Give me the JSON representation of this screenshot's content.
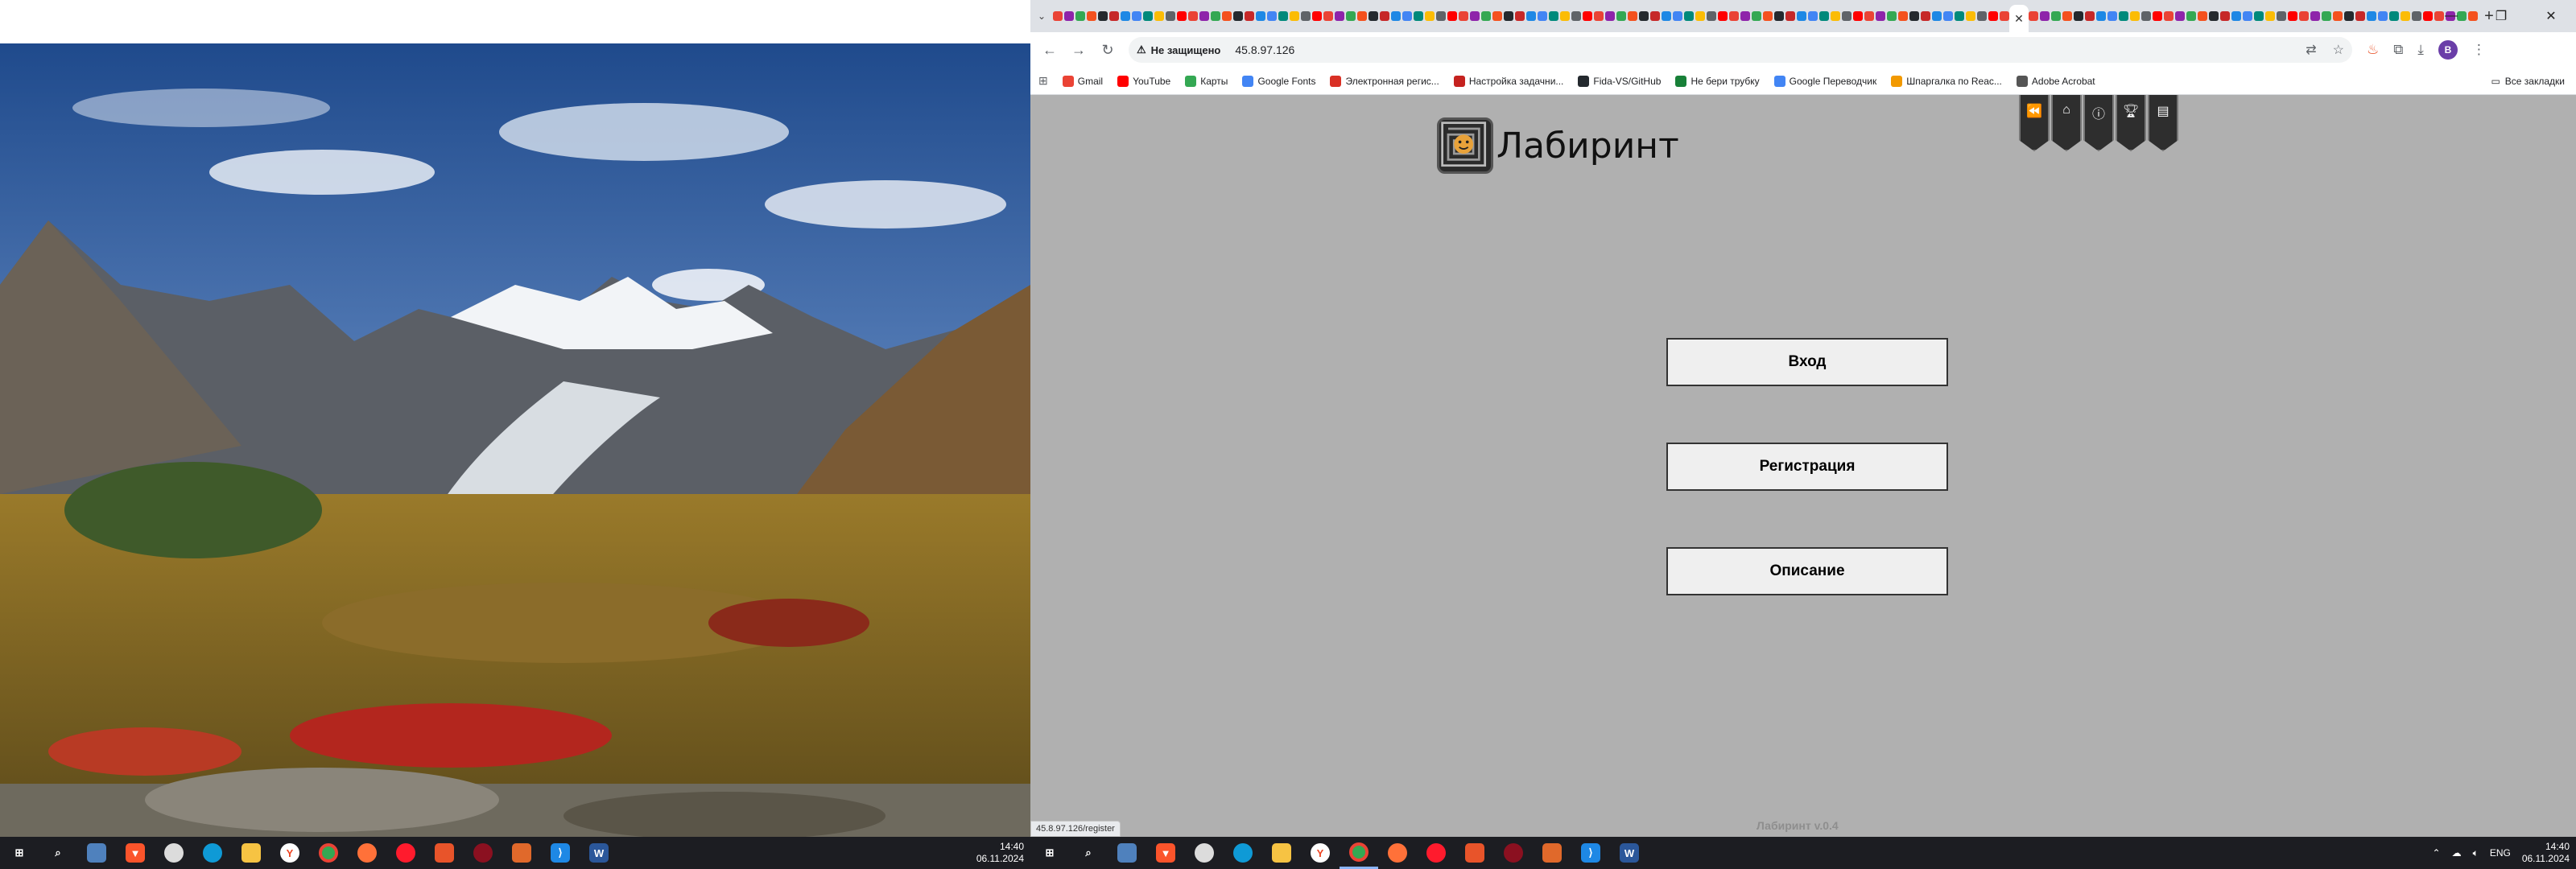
{
  "browser": {
    "url": "45.8.97.126",
    "security_label": "Не защищено",
    "status_url": "45.8.97.126/register",
    "profile_initial": "B",
    "bookmarks": [
      {
        "label": "Gmail",
        "color": "#ea4335"
      },
      {
        "label": "YouTube",
        "color": "#ff0000"
      },
      {
        "label": "Карты",
        "color": "#34a853"
      },
      {
        "label": "Google Fonts",
        "color": "#4285f4"
      },
      {
        "label": "Электронная регис...",
        "color": "#d93025"
      },
      {
        "label": "Настройка задачни...",
        "color": "#c5221f"
      },
      {
        "label": "Fida-VS/GitHub",
        "color": "#24292e"
      },
      {
        "label": "Не бери трубку",
        "color": "#188038"
      },
      {
        "label": "Google Переводчик",
        "color": "#4285f4"
      },
      {
        "label": "Шпаргалка по Reac...",
        "color": "#f29900"
      },
      {
        "label": "Adobe Acrobat",
        "color": "#555555"
      }
    ],
    "all_bookmarks_label": "Все закладки"
  },
  "page": {
    "logo_title": "Лабиринт",
    "buttons": {
      "login": "Вход",
      "register": "Регистрация",
      "about": "Описание"
    },
    "ribbon_icons": [
      "rewind-icon",
      "home-icon",
      "info-icon",
      "trophy-icon",
      "document-icon"
    ],
    "version": "Лабиринт v.0.4"
  },
  "taskbars": {
    "left_clock": {
      "time": "14:40",
      "date": "06.11.2024"
    },
    "right_clock": {
      "time": "14:40",
      "date": "06.11.2024"
    },
    "language": "ENG"
  }
}
